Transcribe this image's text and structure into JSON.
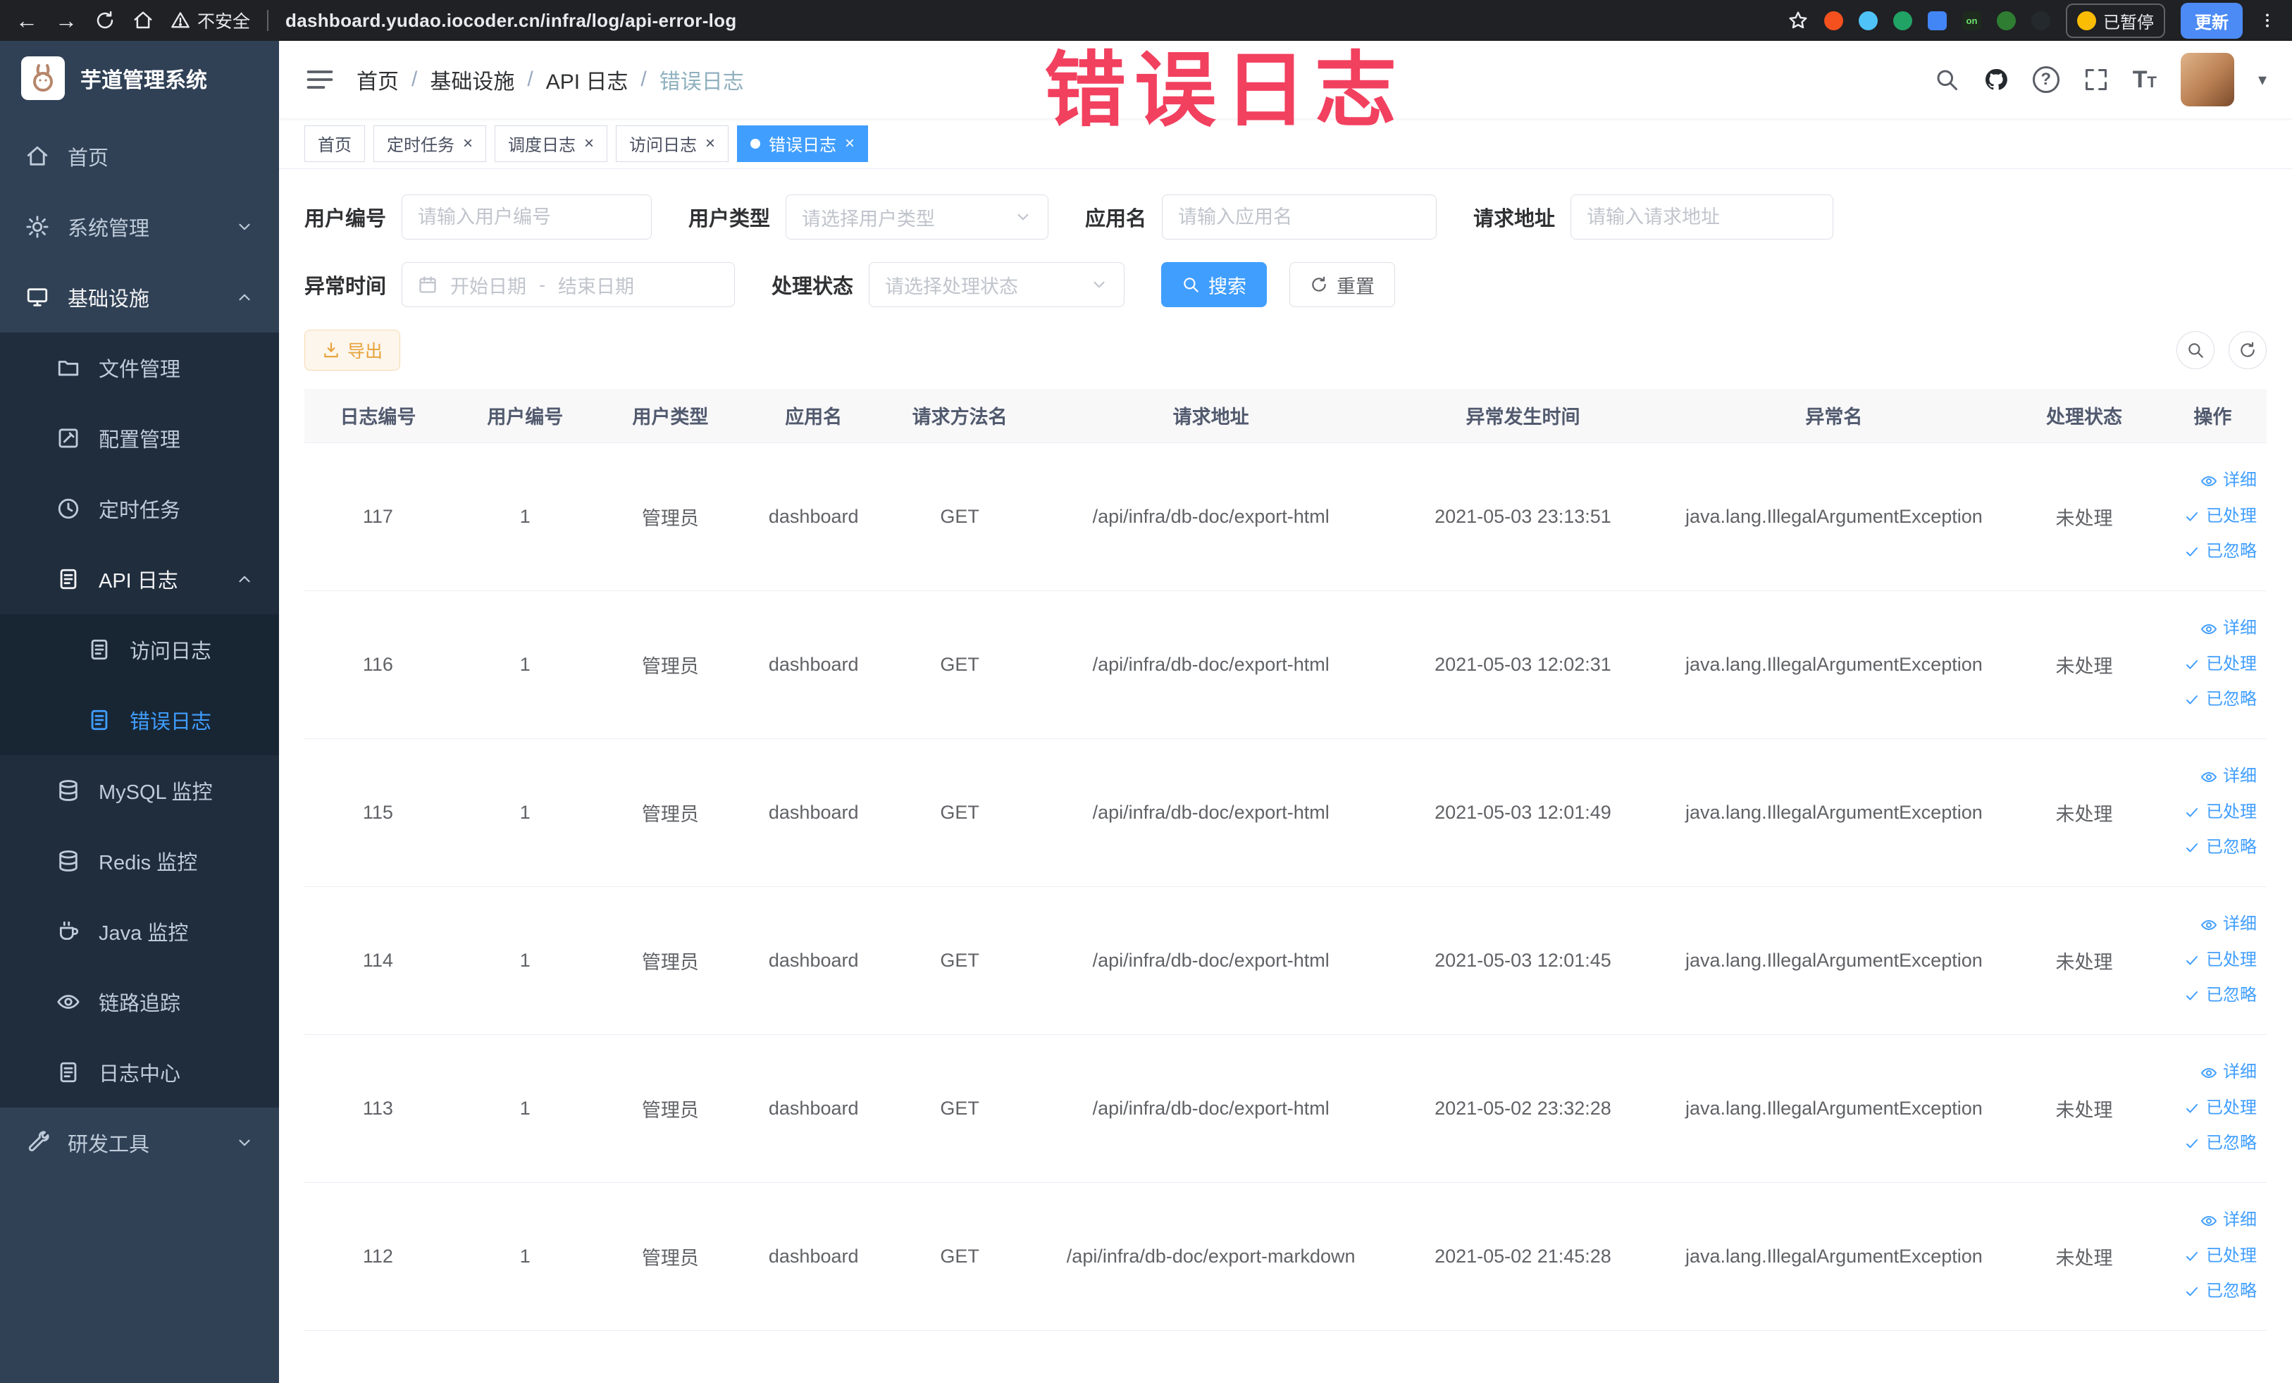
{
  "colors": {
    "primary": "#409eff",
    "annotation": "#f2405f",
    "warning": "#e6a23c",
    "sidebar_bg": "#304156"
  },
  "annotation": {
    "text": "错误日志"
  },
  "icons": {
    "back": "←",
    "forward": "→",
    "close": "×",
    "caret_down": "▾",
    "question": "?",
    "text_size_large": "T",
    "text_size_small": "T",
    "breadcrumb_separator": "/",
    "extension_badge": "on"
  },
  "browser": {
    "security_label": "不安全",
    "url": "dashboard.yudao.iocoder.cn/infra/log/api-error-log",
    "paused_label": "已暂停",
    "update_label": "更新"
  },
  "sidebar": {
    "logo_title": "芋道管理系统",
    "items": {
      "home": "首页",
      "system": "系统管理",
      "infra": "基础设施",
      "file": "文件管理",
      "config": "配置管理",
      "job": "定时任务",
      "api_log": "API 日志",
      "access_log": "访问日志",
      "error_log": "错误日志",
      "mysql": "MySQL 监控",
      "redis": "Redis 监控",
      "java": "Java 监控",
      "trace": "链路追踪",
      "log_center": "日志中心",
      "dev_tools": "研发工具"
    }
  },
  "breadcrumb": {
    "items": [
      "首页",
      "基础设施",
      "API 日志",
      "错误日志"
    ]
  },
  "tags": [
    {
      "label": "首页",
      "closable": false,
      "active": false
    },
    {
      "label": "定时任务",
      "closable": true,
      "active": false
    },
    {
      "label": "调度日志",
      "closable": true,
      "active": false
    },
    {
      "label": "访问日志",
      "closable": true,
      "active": false
    },
    {
      "label": "错误日志",
      "closable": true,
      "active": true
    }
  ],
  "filters": {
    "user_id": {
      "label": "用户编号",
      "placeholder": "请输入用户编号"
    },
    "user_type": {
      "label": "用户类型",
      "placeholder": "请选择用户类型"
    },
    "app_name": {
      "label": "应用名",
      "placeholder": "请输入应用名"
    },
    "request_url": {
      "label": "请求地址",
      "placeholder": "请输入请求地址"
    },
    "exception_time": {
      "label": "异常时间",
      "start_placeholder": "开始日期",
      "separator": "-",
      "end_placeholder": "结束日期"
    },
    "process_status": {
      "label": "处理状态",
      "placeholder": "请选择处理状态"
    },
    "search_label": "搜索",
    "reset_label": "重置"
  },
  "toolbar": {
    "export_label": "导出"
  },
  "table": {
    "columns": [
      "日志编号",
      "用户编号",
      "用户类型",
      "应用名",
      "请求方法名",
      "请求地址",
      "异常发生时间",
      "异常名",
      "处理状态",
      "操作"
    ],
    "actions": {
      "detail": "详细",
      "processed": "已处理",
      "ignore": "已忽略"
    },
    "rows": [
      {
        "id": "117",
        "user_id": "1",
        "user_type": "管理员",
        "app": "dashboard",
        "method": "GET",
        "url": "/api/infra/db-doc/export-html",
        "time": "2021-05-03 23:13:51",
        "exception": "java.lang.IllegalArgumentException",
        "status": "未处理"
      },
      {
        "id": "116",
        "user_id": "1",
        "user_type": "管理员",
        "app": "dashboard",
        "method": "GET",
        "url": "/api/infra/db-doc/export-html",
        "time": "2021-05-03 12:02:31",
        "exception": "java.lang.IllegalArgumentException",
        "status": "未处理"
      },
      {
        "id": "115",
        "user_id": "1",
        "user_type": "管理员",
        "app": "dashboard",
        "method": "GET",
        "url": "/api/infra/db-doc/export-html",
        "time": "2021-05-03 12:01:49",
        "exception": "java.lang.IllegalArgumentException",
        "status": "未处理"
      },
      {
        "id": "114",
        "user_id": "1",
        "user_type": "管理员",
        "app": "dashboard",
        "method": "GET",
        "url": "/api/infra/db-doc/export-html",
        "time": "2021-05-03 12:01:45",
        "exception": "java.lang.IllegalArgumentException",
        "status": "未处理"
      },
      {
        "id": "113",
        "user_id": "1",
        "user_type": "管理员",
        "app": "dashboard",
        "method": "GET",
        "url": "/api/infra/db-doc/export-html",
        "time": "2021-05-02 23:32:28",
        "exception": "java.lang.IllegalArgumentException",
        "status": "未处理"
      },
      {
        "id": "112",
        "user_id": "1",
        "user_type": "管理员",
        "app": "dashboard",
        "method": "GET",
        "url": "/api/infra/db-doc/export-markdown",
        "time": "2021-05-02 21:45:28",
        "exception": "java.lang.IllegalArgumentException",
        "status": "未处理"
      }
    ]
  }
}
